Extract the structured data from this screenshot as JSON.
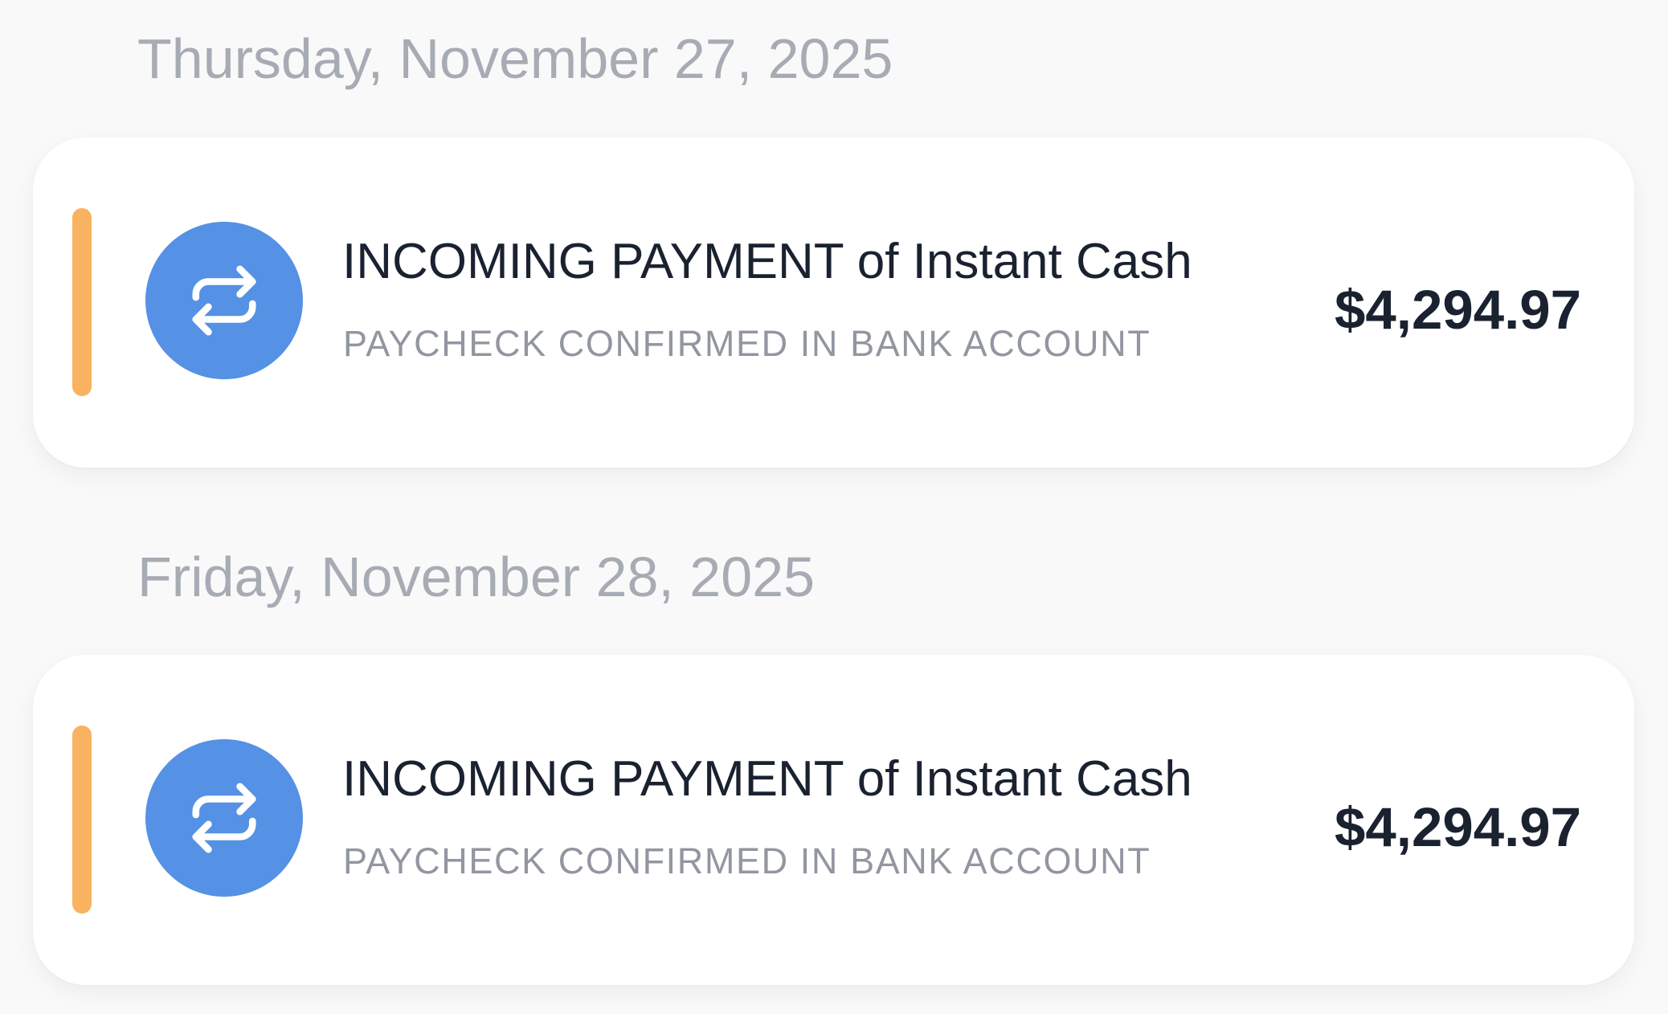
{
  "colors": {
    "background": "#f9f9fa",
    "card": "#ffffff",
    "accent_bar": "#f8b260",
    "icon_circle": "#5591e4",
    "icon_glyph": "#ffffff",
    "date_text": "#a7abb4",
    "title_text": "#1a2230",
    "subtitle_text": "#9296a0",
    "amount_text": "#1a2230"
  },
  "feed": [
    {
      "date": "Thursday, November 27, 2025",
      "transactions": [
        {
          "icon": "repeat-transfer-icon",
          "title": "INCOMING PAYMENT of Instant Cash",
          "subtitle": "PAYCHECK CONFIRMED IN BANK ACCOUNT",
          "amount": "$4,294.97"
        }
      ]
    },
    {
      "date": "Friday, November 28, 2025",
      "transactions": [
        {
          "icon": "repeat-transfer-icon",
          "title": "INCOMING PAYMENT of Instant Cash",
          "subtitle": "PAYCHECK CONFIRMED IN BANK ACCOUNT",
          "amount": "$4,294.97"
        }
      ]
    }
  ]
}
